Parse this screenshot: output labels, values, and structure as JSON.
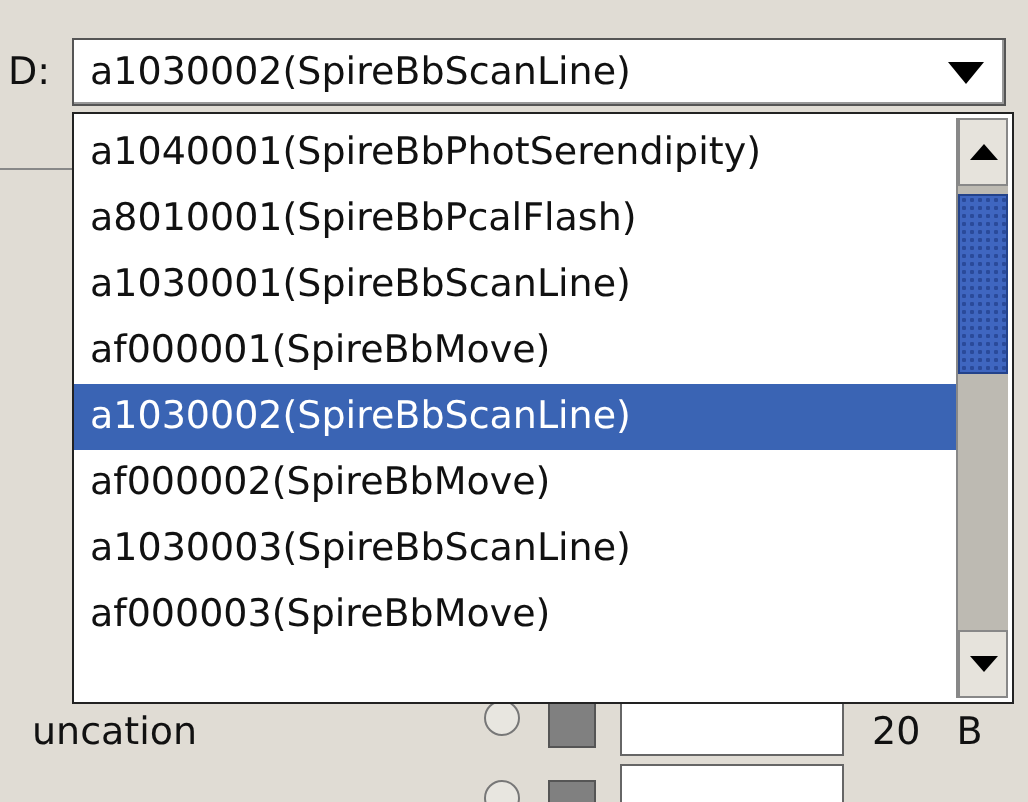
{
  "field_label": "D:",
  "combo": {
    "value": "a1030002(SpireBbScanLine)"
  },
  "dropdown": {
    "items": [
      {
        "label": "a1040001(SpireBbPhotSerendipity)",
        "selected": false
      },
      {
        "label": "a8010001(SpireBbPcalFlash)",
        "selected": false
      },
      {
        "label": "a1030001(SpireBbScanLine)",
        "selected": false
      },
      {
        "label": "af000001(SpireBbMove)",
        "selected": false
      },
      {
        "label": "a1030002(SpireBbScanLine)",
        "selected": true
      },
      {
        "label": "af000002(SpireBbMove)",
        "selected": false
      },
      {
        "label": "a1030003(SpireBbScanLine)",
        "selected": false
      },
      {
        "label": "af000003(SpireBbMove)",
        "selected": false
      }
    ]
  },
  "rows": [
    {
      "label": "uncation",
      "selected": false,
      "number": "20",
      "name": "B"
    },
    {
      "selected": false
    }
  ]
}
